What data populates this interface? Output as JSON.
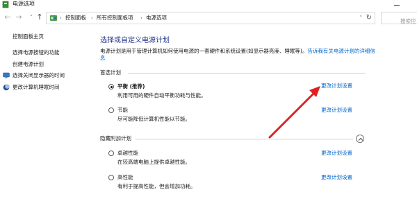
{
  "window": {
    "title": "电源选项"
  },
  "address": {
    "crumbs": [
      "控制面板",
      "所有控制面板项",
      "电源选项"
    ],
    "search_placeholder": "搜索控"
  },
  "sidebar": {
    "items": [
      {
        "label": "控制面板主页"
      },
      {
        "label": "选择电源按钮的功能"
      },
      {
        "label": "创建电源计划"
      },
      {
        "label": "选择关闭显示器的时间"
      },
      {
        "label": "更改计算机睡眠时间"
      }
    ]
  },
  "main": {
    "title": "选择或自定义电源计划",
    "desc_text": "电源计划是用于管理计算机如何使用电源的一套硬件和系统设置(如显示器亮度、睡眠等)。",
    "desc_link": "告诉我有关电源计划的详细信息"
  },
  "preferred": {
    "label": "首选计划",
    "plans": [
      {
        "name": "平衡 (推荐)",
        "desc": "利用可用的硬件自动平衡功耗与性能。",
        "link": "更改计划设置",
        "selected": true
      },
      {
        "name": "节能",
        "desc": "尽可能降低计算机性能以节能。",
        "link": "更改计划设置",
        "selected": false
      }
    ]
  },
  "hidden": {
    "label": "隐藏附加计划",
    "plans": [
      {
        "name": "卓越性能",
        "desc": "在较高端电脑上提供卓越性能。",
        "link": "更改计划设置",
        "selected": false
      },
      {
        "name": "高性能",
        "desc": "有利于提高性能，但会增加功耗。",
        "link": "更改计划设置",
        "selected": false
      }
    ]
  },
  "colors": {
    "title_blue": "#1e3287",
    "link_blue": "#0066cc",
    "arrow_red": "#e02020"
  }
}
